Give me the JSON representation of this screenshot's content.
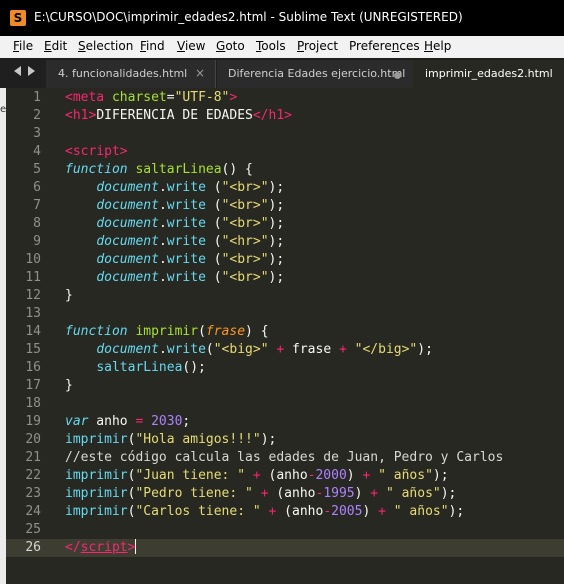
{
  "window": {
    "title": "E:\\CURSO\\DOC\\imprimir_edades2.html - Sublime Text (UNREGISTERED)",
    "app_icon_letter": "S"
  },
  "menu": [
    {
      "accel": "F",
      "rest": "ile"
    },
    {
      "accel": "E",
      "rest": "dit"
    },
    {
      "accel": "S",
      "rest": "election"
    },
    {
      "accel": "F",
      "rest": "ind",
      "pre": ""
    },
    {
      "accel": "V",
      "rest": "iew"
    },
    {
      "accel": "G",
      "rest": "oto"
    },
    {
      "accel": "T",
      "rest": "ools"
    },
    {
      "accel": "P",
      "rest": "roject"
    },
    {
      "accel": "n",
      "rest": "ces",
      "pre": "Prefere"
    },
    {
      "accel": "H",
      "rest": "elp"
    }
  ],
  "tabs": [
    {
      "label": "4. funcionalidades.html",
      "close": "×"
    },
    {
      "label": "Diferencia Edades ejercicio.html"
    },
    {
      "label": "imprimir_edades2.html"
    }
  ],
  "left_edge_mark": "e",
  "editor": {
    "current_line": 26,
    "lines": [
      {
        "n": "1",
        "tokens": [
          {
            "c": "tag",
            "t": "<meta "
          },
          {
            "c": "attr",
            "t": "charset"
          },
          {
            "c": "plain",
            "t": "="
          },
          {
            "c": "str",
            "t": "\"UTF-8\""
          },
          {
            "c": "tag",
            "t": ">"
          }
        ]
      },
      {
        "n": "2",
        "tokens": [
          {
            "c": "tag",
            "t": "<h1>"
          },
          {
            "c": "plain",
            "t": "DIFERENCIA DE EDADES"
          },
          {
            "c": "tag",
            "t": "</h1>"
          }
        ]
      },
      {
        "n": "3",
        "tokens": []
      },
      {
        "n": "4",
        "tokens": [
          {
            "c": "tag",
            "t": "<script>"
          }
        ]
      },
      {
        "n": "5",
        "tokens": [
          {
            "c": "kw",
            "t": "function"
          },
          {
            "c": "plain",
            "t": " "
          },
          {
            "c": "fn",
            "t": "saltarLinea"
          },
          {
            "c": "plain",
            "t": "() {"
          }
        ]
      },
      {
        "n": "6",
        "tokens": [
          {
            "c": "plain",
            "t": "    "
          },
          {
            "c": "doc",
            "t": "document"
          },
          {
            "c": "plain",
            "t": "."
          },
          {
            "c": "call",
            "t": "write"
          },
          {
            "c": "plain",
            "t": " ("
          },
          {
            "c": "str",
            "t": "\"<br>\""
          },
          {
            "c": "plain",
            "t": ");"
          }
        ]
      },
      {
        "n": "7",
        "tokens": [
          {
            "c": "plain",
            "t": "    "
          },
          {
            "c": "doc",
            "t": "document"
          },
          {
            "c": "plain",
            "t": "."
          },
          {
            "c": "call",
            "t": "write"
          },
          {
            "c": "plain",
            "t": " ("
          },
          {
            "c": "str",
            "t": "\"<br>\""
          },
          {
            "c": "plain",
            "t": ");"
          }
        ]
      },
      {
        "n": "8",
        "tokens": [
          {
            "c": "plain",
            "t": "    "
          },
          {
            "c": "doc",
            "t": "document"
          },
          {
            "c": "plain",
            "t": "."
          },
          {
            "c": "call",
            "t": "write"
          },
          {
            "c": "plain",
            "t": " ("
          },
          {
            "c": "str",
            "t": "\"<br>\""
          },
          {
            "c": "plain",
            "t": ");"
          }
        ]
      },
      {
        "n": "9",
        "tokens": [
          {
            "c": "plain",
            "t": "    "
          },
          {
            "c": "doc",
            "t": "document"
          },
          {
            "c": "plain",
            "t": "."
          },
          {
            "c": "call",
            "t": "write"
          },
          {
            "c": "plain",
            "t": " ("
          },
          {
            "c": "str",
            "t": "\"<hr>\""
          },
          {
            "c": "plain",
            "t": ");"
          }
        ]
      },
      {
        "n": "10",
        "tokens": [
          {
            "c": "plain",
            "t": "    "
          },
          {
            "c": "doc",
            "t": "document"
          },
          {
            "c": "plain",
            "t": "."
          },
          {
            "c": "call",
            "t": "write"
          },
          {
            "c": "plain",
            "t": " ("
          },
          {
            "c": "str",
            "t": "\"<br>\""
          },
          {
            "c": "plain",
            "t": ");"
          }
        ]
      },
      {
        "n": "11",
        "tokens": [
          {
            "c": "plain",
            "t": "    "
          },
          {
            "c": "doc",
            "t": "document"
          },
          {
            "c": "plain",
            "t": "."
          },
          {
            "c": "call",
            "t": "write"
          },
          {
            "c": "plain",
            "t": " ("
          },
          {
            "c": "str",
            "t": "\"<br>\""
          },
          {
            "c": "plain",
            "t": ");"
          }
        ]
      },
      {
        "n": "12",
        "tokens": [
          {
            "c": "plain",
            "t": "}"
          }
        ]
      },
      {
        "n": "13",
        "tokens": []
      },
      {
        "n": "14",
        "tokens": [
          {
            "c": "kw",
            "t": "function"
          },
          {
            "c": "plain",
            "t": " "
          },
          {
            "c": "fn",
            "t": "imprimir"
          },
          {
            "c": "plain",
            "t": "("
          },
          {
            "c": "param",
            "t": "frase"
          },
          {
            "c": "plain",
            "t": ") {"
          }
        ]
      },
      {
        "n": "15",
        "tokens": [
          {
            "c": "plain",
            "t": "    "
          },
          {
            "c": "doc",
            "t": "document"
          },
          {
            "c": "plain",
            "t": "."
          },
          {
            "c": "call",
            "t": "write"
          },
          {
            "c": "plain",
            "t": "("
          },
          {
            "c": "str",
            "t": "\"<big>\""
          },
          {
            "c": "plain",
            "t": " "
          },
          {
            "c": "op",
            "t": "+"
          },
          {
            "c": "plain",
            "t": " frase "
          },
          {
            "c": "op",
            "t": "+"
          },
          {
            "c": "plain",
            "t": " "
          },
          {
            "c": "str",
            "t": "\"</big>\""
          },
          {
            "c": "plain",
            "t": ");"
          }
        ]
      },
      {
        "n": "16",
        "tokens": [
          {
            "c": "plain",
            "t": "    "
          },
          {
            "c": "call",
            "t": "saltarLinea"
          },
          {
            "c": "plain",
            "t": "();"
          }
        ]
      },
      {
        "n": "17",
        "tokens": [
          {
            "c": "plain",
            "t": "}"
          }
        ]
      },
      {
        "n": "18",
        "tokens": []
      },
      {
        "n": "19",
        "tokens": [
          {
            "c": "kw",
            "t": "var"
          },
          {
            "c": "plain",
            "t": " anho "
          },
          {
            "c": "op",
            "t": "="
          },
          {
            "c": "plain",
            "t": " "
          },
          {
            "c": "num",
            "t": "2030"
          },
          {
            "c": "plain",
            "t": ";"
          }
        ]
      },
      {
        "n": "20",
        "tokens": [
          {
            "c": "call",
            "t": "imprimir"
          },
          {
            "c": "plain",
            "t": "("
          },
          {
            "c": "str",
            "t": "\"Hola amigos!!!\""
          },
          {
            "c": "plain",
            "t": ");"
          }
        ]
      },
      {
        "n": "21",
        "tokens": [
          {
            "c": "com",
            "t": "//este código calcula las edades de Juan, Pedro y Carlos"
          }
        ]
      },
      {
        "n": "22",
        "tokens": [
          {
            "c": "call",
            "t": "imprimir"
          },
          {
            "c": "plain",
            "t": "("
          },
          {
            "c": "str",
            "t": "\"Juan tiene: \""
          },
          {
            "c": "plain",
            "t": " "
          },
          {
            "c": "op",
            "t": "+"
          },
          {
            "c": "plain",
            "t": " (anho"
          },
          {
            "c": "op",
            "t": "-"
          },
          {
            "c": "num",
            "t": "2000"
          },
          {
            "c": "plain",
            "t": ") "
          },
          {
            "c": "op",
            "t": "+"
          },
          {
            "c": "plain",
            "t": " "
          },
          {
            "c": "str",
            "t": "\" años\""
          },
          {
            "c": "plain",
            "t": ");"
          }
        ]
      },
      {
        "n": "23",
        "tokens": [
          {
            "c": "call",
            "t": "imprimir"
          },
          {
            "c": "plain",
            "t": "("
          },
          {
            "c": "str",
            "t": "\"Pedro tiene: \""
          },
          {
            "c": "plain",
            "t": " "
          },
          {
            "c": "op",
            "t": "+"
          },
          {
            "c": "plain",
            "t": " (anho"
          },
          {
            "c": "op",
            "t": "-"
          },
          {
            "c": "num",
            "t": "1995"
          },
          {
            "c": "plain",
            "t": ") "
          },
          {
            "c": "op",
            "t": "+"
          },
          {
            "c": "plain",
            "t": " "
          },
          {
            "c": "str",
            "t": "\" años\""
          },
          {
            "c": "plain",
            "t": ");"
          }
        ]
      },
      {
        "n": "24",
        "tokens": [
          {
            "c": "call",
            "t": "imprimir"
          },
          {
            "c": "plain",
            "t": "("
          },
          {
            "c": "str",
            "t": "\"Carlos tiene: \""
          },
          {
            "c": "plain",
            "t": " "
          },
          {
            "c": "op",
            "t": "+"
          },
          {
            "c": "plain",
            "t": " (anho"
          },
          {
            "c": "op",
            "t": "-"
          },
          {
            "c": "num",
            "t": "2005"
          },
          {
            "c": "plain",
            "t": ") "
          },
          {
            "c": "op",
            "t": "+"
          },
          {
            "c": "plain",
            "t": " "
          },
          {
            "c": "str",
            "t": "\" años\""
          },
          {
            "c": "plain",
            "t": ");"
          }
        ]
      },
      {
        "n": "25",
        "tokens": []
      },
      {
        "n": "26",
        "tokens": [
          {
            "c": "tag",
            "t": "</"
          },
          {
            "c": "tag",
            "t": "script",
            "u": true
          },
          {
            "c": "tag",
            "t": ">"
          }
        ]
      }
    ]
  }
}
